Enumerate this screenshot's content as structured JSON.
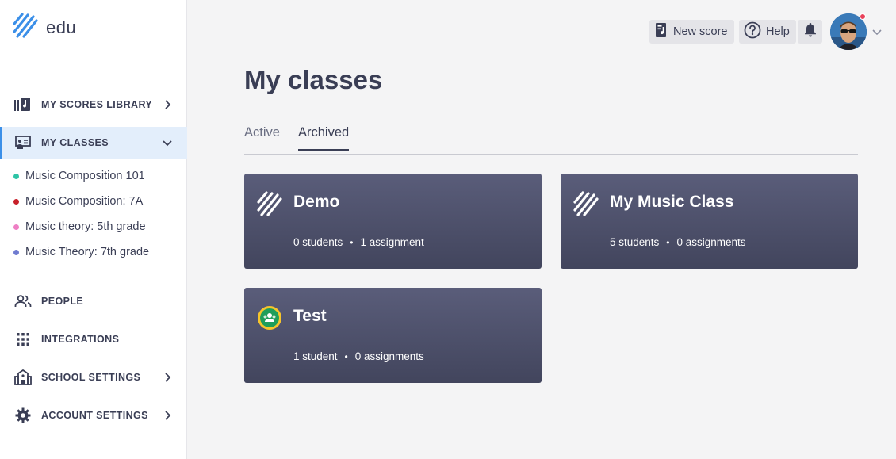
{
  "app": {
    "logo_text": "edu"
  },
  "sidebar": {
    "library": {
      "label": "MY SCORES LIBRARY"
    },
    "classes": {
      "label": "MY CLASSES"
    },
    "class_list": [
      {
        "label": "Music Composition 101",
        "color": "#2ec4a6"
      },
      {
        "label": "Music Composition: 7A",
        "color": "#c8202a"
      },
      {
        "label": "Music theory: 5th grade",
        "color": "#ee7fc4"
      },
      {
        "label": "Music Theory: 7th grade",
        "color": "#6f7bd0"
      }
    ],
    "people": {
      "label": "PEOPLE"
    },
    "integrations": {
      "label": "INTEGRATIONS"
    },
    "school_settings": {
      "label": "SCHOOL SETTINGS"
    },
    "account_settings": {
      "label": "ACCOUNT SETTINGS"
    }
  },
  "header": {
    "new_score": "New score",
    "help": "Help"
  },
  "main": {
    "title": "My classes",
    "tabs": {
      "active": "Active",
      "archived": "Archived"
    },
    "cards": [
      {
        "title": "Demo",
        "students": "0 students",
        "assignments": "1 assignment",
        "icon": "stripes-logo-icon"
      },
      {
        "title": "My Music Class",
        "students": "5 students",
        "assignments": "0 assignments",
        "icon": "stripes-logo-icon"
      },
      {
        "title": "Test",
        "students": "1 student",
        "assignments": "0 assignments",
        "icon": "google-classroom-icon"
      }
    ],
    "separator": "•"
  },
  "colors": {
    "accent": "#3b8fe8",
    "active_bg": "#e3eefb",
    "card_top": "#5a5d7a",
    "card_bottom": "#42455d",
    "notification": "#e8425a"
  }
}
